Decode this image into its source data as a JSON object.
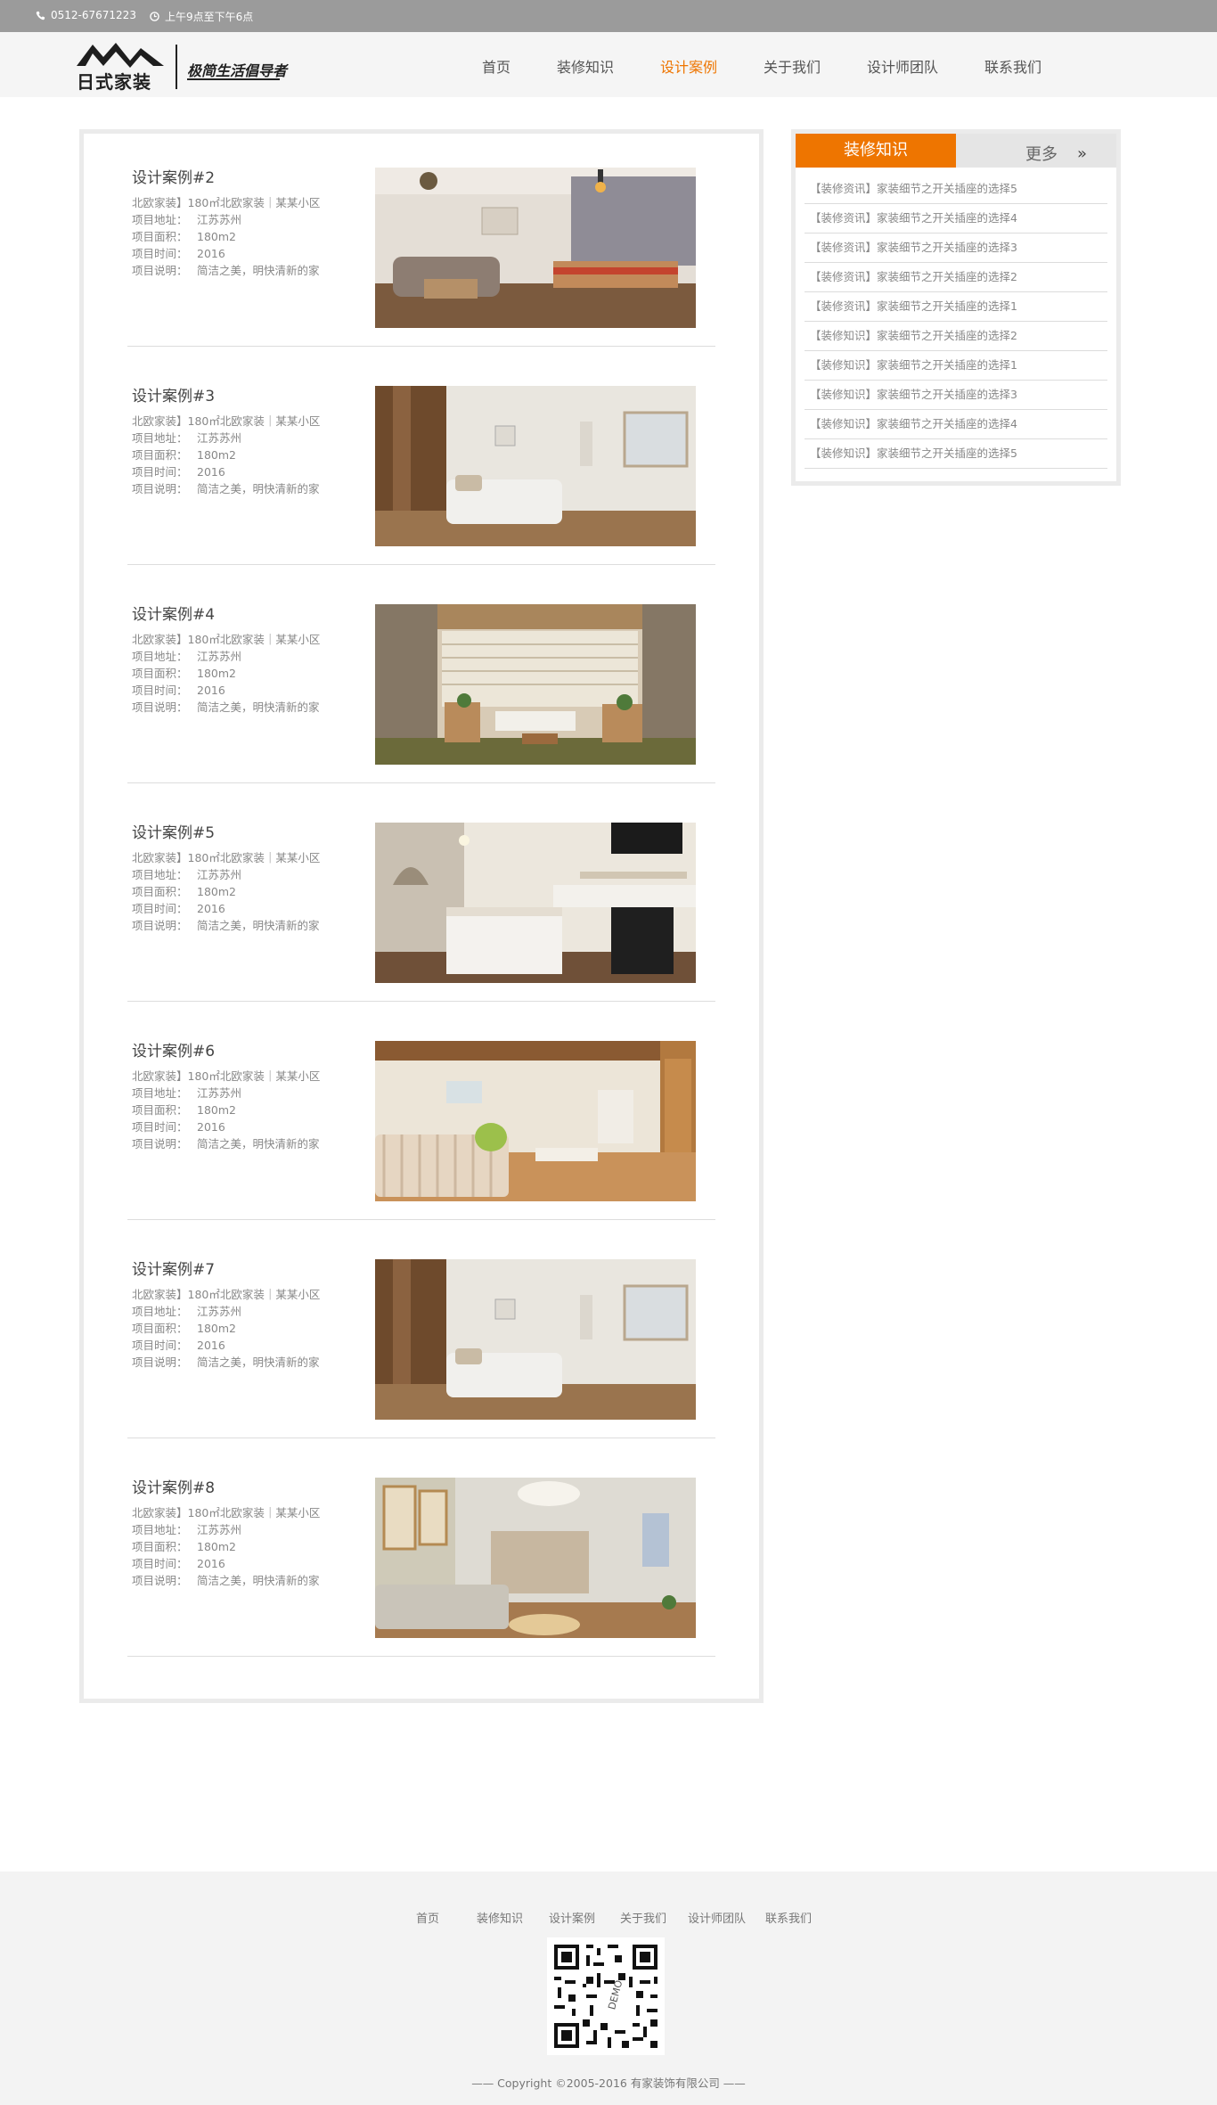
{
  "topbar": {
    "phone": "0512-67671223",
    "hours": "上午9点至下午6点"
  },
  "header": {
    "brand": "日式家装",
    "slogan": "极简生活倡导者",
    "nav": [
      "首页",
      "装修知识",
      "设计案例",
      "关于我们",
      "设计师团队",
      "联系我们"
    ],
    "active_nav": "设计案例"
  },
  "colors": {
    "accent": "#ee7500",
    "topbar": "#9b9b9b",
    "header_bg": "#f5f5f5",
    "footer_bg": "#f3f3f3"
  },
  "labels": {
    "address": "项目地址：",
    "area": "项目面积：",
    "time": "项目时间：",
    "desc": "项目说明："
  },
  "cases": [
    {
      "title": "设计案例#2",
      "subtitle": "北欧家装】180㎡北欧家装｜某某小区",
      "address": "江苏苏州",
      "area": "180m2",
      "time": "2016",
      "desc": "简洁之美，明快清新的家",
      "image": "living-room-with-dining"
    },
    {
      "title": "设计案例#3",
      "subtitle": "北欧家装】180㎡北欧家装｜某某小区",
      "address": "江苏苏州",
      "area": "180m2",
      "time": "2016",
      "desc": "简洁之美，明快清新的家",
      "image": "living-room-white-sofa"
    },
    {
      "title": "设计案例#4",
      "subtitle": "北欧家装】180㎡北欧家装｜某某小区",
      "address": "江苏苏州",
      "area": "180m2",
      "time": "2016",
      "desc": "简洁之美，明快清新的家",
      "image": "sunroom-with-blinds"
    },
    {
      "title": "设计案例#5",
      "subtitle": "北欧家装】180㎡北欧家装｜某某小区",
      "address": "江苏苏州",
      "area": "180m2",
      "time": "2016",
      "desc": "简洁之美，明快清新的家",
      "image": "white-kitchen"
    },
    {
      "title": "设计案例#6",
      "subtitle": "北欧家装】180㎡北欧家装｜某某小区",
      "address": "江苏苏州",
      "area": "180m2",
      "time": "2016",
      "desc": "简洁之美，明快清新的家",
      "image": "living-room-striped-sofa"
    },
    {
      "title": "设计案例#7",
      "subtitle": "北欧家装】180㎡北欧家装｜某某小区",
      "address": "江苏苏州",
      "area": "180m2",
      "time": "2016",
      "desc": "简洁之美，明快清新的家",
      "image": "living-room-white-sofa"
    },
    {
      "title": "设计案例#8",
      "subtitle": "北欧家装】180㎡北欧家装｜某某小区",
      "address": "江苏苏州",
      "area": "180m2",
      "time": "2016",
      "desc": "简洁之美，明快清新的家",
      "image": "living-room-pendant-lamp"
    }
  ],
  "sidebar": {
    "tab": "装修知识",
    "more": "更多",
    "more_icon": "»",
    "items": [
      "【装修资讯】家装细节之开关插座的选择5",
      "【装修资讯】家装细节之开关插座的选择4",
      "【装修资讯】家装细节之开关插座的选择3",
      "【装修资讯】家装细节之开关插座的选择2",
      "【装修资讯】家装细节之开关插座的选择1",
      "【装修知识】家装细节之开关插座的选择2",
      "【装修知识】家装细节之开关插座的选择1",
      "【装修知识】家装细节之开关插座的选择3",
      "【装修知识】家装细节之开关插座的选择4",
      "【装修知识】家装细节之开关插座的选择5"
    ]
  },
  "footer": {
    "nav": [
      "首页",
      "装修知识",
      "设计案例",
      "关于我们",
      "设计师团队",
      "联系我们"
    ],
    "qr_text": "DEMO",
    "copyright": "—— Copyright ©2005-2016 有家装饰有限公司 ——"
  }
}
